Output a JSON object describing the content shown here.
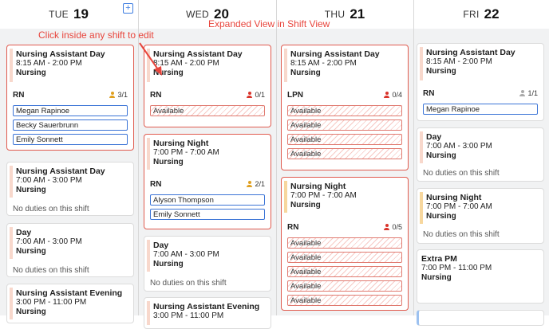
{
  "days": [
    {
      "dow": "TUE",
      "num": "19"
    },
    {
      "dow": "WED",
      "num": "20"
    },
    {
      "dow": "THU",
      "num": "21"
    },
    {
      "dow": "FRI",
      "num": "22"
    }
  ],
  "add_icon": "plus-icon",
  "annotations": {
    "instruction": "Click inside any shift to edit",
    "view_label": "Expanded View in Shift View"
  },
  "colors": {
    "accent_red": "#e05b4f",
    "assign_blue": "#3b74d6",
    "stripe_peach": "#f8d8cc",
    "stripe_amber": "#f7d79e"
  },
  "tue": {
    "s1": {
      "name": "Nursing Assistant Day",
      "time": "8:15 AM - 2:00 PM",
      "dept": "Nursing",
      "role": "RN",
      "count": "3/1",
      "people": [
        "Megan Rapinoe",
        "Becky Sauerbrunn",
        "Emily Sonnett"
      ]
    },
    "s2": {
      "name": "Nursing Assistant Day",
      "time": "7:00 AM - 3:00 PM",
      "dept": "Nursing",
      "empty": "No duties on this shift"
    },
    "s3": {
      "name": "Day",
      "time": "7:00 AM - 3:00 PM",
      "dept": "Nursing",
      "empty": "No duties on this shift"
    },
    "s4": {
      "name": "Nursing Assistant Evening",
      "time": "3:00 PM - 11:00 PM",
      "dept": "Nursing"
    }
  },
  "wed": {
    "s1": {
      "name": "Nursing Assistant Day",
      "time": "8:15 AM - 2:00 PM",
      "dept": "Nursing",
      "role": "RN",
      "count": "0/1",
      "slots": [
        "Available"
      ]
    },
    "s2": {
      "name": "Nursing Night",
      "time": "7:00 PM - 7:00 AM",
      "dept": "Nursing",
      "role": "RN",
      "count": "2/1",
      "people": [
        "Alyson Thompson",
        "Emily Sonnett"
      ]
    },
    "s3": {
      "name": "Day",
      "time": "7:00 AM - 3:00 PM",
      "dept": "Nursing",
      "empty": "No duties on this shift"
    },
    "s4": {
      "name": "Nursing Assistant Evening",
      "time": "3:00 PM - 11:00 PM"
    }
  },
  "thu": {
    "s1": {
      "name": "Nursing Assistant Day",
      "time": "8:15 AM - 2:00 PM",
      "dept": "Nursing",
      "role": "LPN",
      "count": "0/4",
      "slots": [
        "Available",
        "Available",
        "Available",
        "Available"
      ]
    },
    "s2": {
      "name": "Nursing Night",
      "time": "7:00 PM - 7:00 AM",
      "dept": "Nursing",
      "role": "RN",
      "count": "0/5",
      "slots": [
        "Available",
        "Available",
        "Available",
        "Available",
        "Available"
      ]
    }
  },
  "fri": {
    "s1": {
      "name": "Nursing Assistant Day",
      "time": "8:15 AM - 2:00 PM",
      "dept": "Nursing",
      "role": "RN",
      "count": "1/1",
      "people": [
        "Megan Rapinoe"
      ]
    },
    "s2": {
      "name": "Day",
      "time": "7:00 AM - 3:00 PM",
      "dept": "Nursing",
      "empty": "No duties on this shift"
    },
    "s3": {
      "name": "Nursing Night",
      "time": "7:00 PM - 7:00 AM",
      "dept": "Nursing",
      "empty": "No duties on this shift"
    },
    "s4": {
      "name": "Extra PM",
      "time": "7:00 PM - 11:00 PM",
      "dept": "Nursing"
    }
  }
}
